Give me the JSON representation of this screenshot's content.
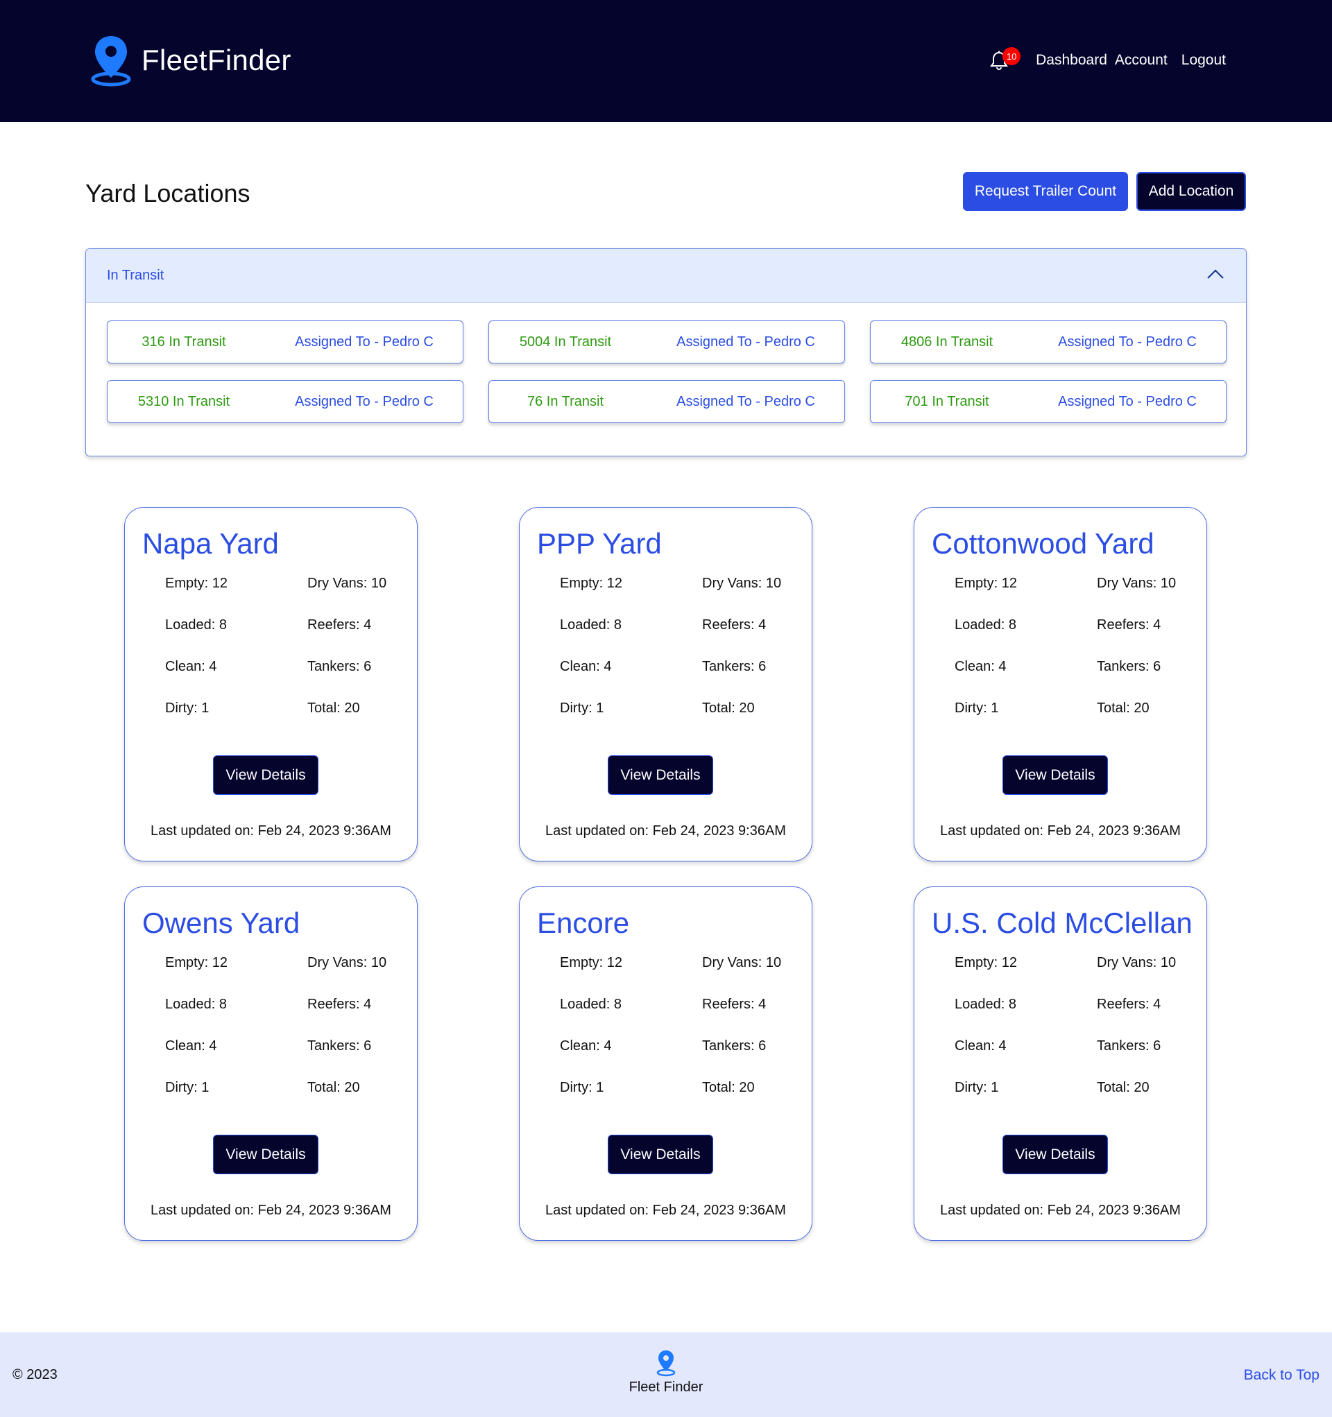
{
  "header": {
    "brand": "FleetFinder",
    "notification_count": "10",
    "nav": [
      "Dashboard",
      "Account",
      "Logout"
    ]
  },
  "page": {
    "title": "Yard Locations",
    "request_button": "Request Trailer Count",
    "add_button": "Add Location"
  },
  "in_transit": {
    "title": "In Transit",
    "items": [
      {
        "id": "316 In Transit",
        "assigned": "Assigned To - Pedro C"
      },
      {
        "id": "5004 In Transit",
        "assigned": "Assigned To - Pedro C"
      },
      {
        "id": "4806 In Transit",
        "assigned": "Assigned To - Pedro C"
      },
      {
        "id": "5310 In Transit",
        "assigned": "Assigned To - Pedro C"
      },
      {
        "id": "76 In Transit",
        "assigned": "Assigned To - Pedro C"
      },
      {
        "id": "701 In Transit",
        "assigned": "Assigned To - Pedro C"
      }
    ]
  },
  "yards": [
    {
      "name": "Napa Yard",
      "empty": "Empty: 12",
      "dry_vans": "Dry Vans: 10",
      "loaded": "Loaded: 8",
      "reefers": "Reefers: 4",
      "clean": "Clean: 4",
      "tankers": "Tankers: 6",
      "dirty": "Dirty: 1",
      "total": "Total: 20",
      "button": "View Details",
      "updated": "Last updated on: Feb 24, 2023 9:36AM"
    },
    {
      "name": "PPP Yard",
      "empty": "Empty: 12",
      "dry_vans": "Dry Vans: 10",
      "loaded": "Loaded: 8",
      "reefers": "Reefers: 4",
      "clean": "Clean: 4",
      "tankers": "Tankers: 6",
      "dirty": "Dirty: 1",
      "total": "Total: 20",
      "button": "View Details",
      "updated": "Last updated on: Feb 24, 2023 9:36AM"
    },
    {
      "name": "Cottonwood Yard",
      "empty": "Empty: 12",
      "dry_vans": "Dry Vans: 10",
      "loaded": "Loaded: 8",
      "reefers": "Reefers: 4",
      "clean": "Clean: 4",
      "tankers": "Tankers: 6",
      "dirty": "Dirty: 1",
      "total": "Total: 20",
      "button": "View Details",
      "updated": "Last updated on: Feb 24, 2023 9:36AM"
    },
    {
      "name": "Owens Yard",
      "empty": "Empty: 12",
      "dry_vans": "Dry Vans: 10",
      "loaded": "Loaded: 8",
      "reefers": "Reefers: 4",
      "clean": "Clean: 4",
      "tankers": "Tankers: 6",
      "dirty": "Dirty: 1",
      "total": "Total: 20",
      "button": "View Details",
      "updated": "Last updated on: Feb 24, 2023 9:36AM"
    },
    {
      "name": "Encore",
      "empty": "Empty: 12",
      "dry_vans": "Dry Vans: 10",
      "loaded": "Loaded: 8",
      "reefers": "Reefers: 4",
      "clean": "Clean: 4",
      "tankers": "Tankers: 6",
      "dirty": "Dirty: 1",
      "total": "Total: 20",
      "button": "View Details",
      "updated": "Last updated on: Feb 24, 2023 9:36AM"
    },
    {
      "name": "U.S. Cold McClellan",
      "empty": "Empty: 12",
      "dry_vans": "Dry Vans: 10",
      "loaded": "Loaded: 8",
      "reefers": "Reefers: 4",
      "clean": "Clean: 4",
      "tankers": "Tankers: 6",
      "dirty": "Dirty: 1",
      "total": "Total: 20",
      "button": "View Details",
      "updated": "Last updated on: Feb 24, 2023 9:36AM"
    }
  ],
  "footer": {
    "copyright": "© 2023",
    "name": "Fleet Finder",
    "back_to_top": "Back to Top"
  },
  "colors": {
    "navy": "#05042d",
    "accent_blue": "#2b4de3",
    "transit_green": "#2e9a12",
    "badge_red": "#ff0000",
    "panel_light": "#e3ebff",
    "pin_blue": "#1e7bff"
  },
  "icons": {
    "logo": "map-pin-icon",
    "notification": "bell-icon",
    "accordion": "chevron-up-icon",
    "footer_logo": "map-pin-icon"
  }
}
